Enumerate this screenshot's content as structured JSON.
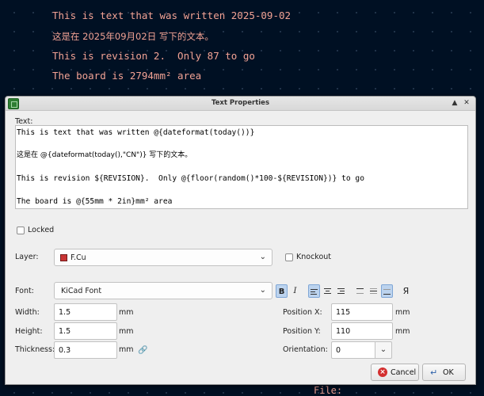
{
  "canvas": {
    "lines": [
      "This is text that was written 2025-09-02",
      "这是在 2025年09月02日 写下的文本。",
      "This is revision 2.  Only 87 to go",
      "The board is 2794mm² area"
    ],
    "bottom_label": "File:"
  },
  "dialog": {
    "title": "Text Properties",
    "text_label": "Text:",
    "text_lines": [
      "This is text that was written @{dateformat(today())}",
      "这是在 @{dateformat(today(),\"CN\")} 写下的文本。",
      "This is revision ${REVISION}.  Only @{floor(random()*100-${REVISION})} to go",
      "The board is @{55mm * 2in}mm² area"
    ],
    "locked_label": "Locked",
    "layer_label": "Layer:",
    "layer_value": "F.Cu",
    "layer_color": "#c83434",
    "knockout_label": "Knockout",
    "font_label": "Font:",
    "font_value": "KiCad Font",
    "bold_label": "B",
    "italic_label": "I",
    "mirror_label": "Я",
    "width_label": "Width:",
    "width_value": "1.5",
    "height_label": "Height:",
    "height_value": "1.5",
    "thickness_label": "Thickness:",
    "thickness_value": "0.3",
    "unit": "mm",
    "pos_x_label": "Position X:",
    "pos_x_value": "115",
    "pos_y_label": "Position Y:",
    "pos_y_value": "110",
    "orientation_label": "Orientation:",
    "orientation_value": "0",
    "cancel_label": "Cancel",
    "ok_label": "OK",
    "cancel_icon": "×",
    "spin_icon": "⌄",
    "link_icon": "🔗",
    "dropdown_icon": "⌄",
    "maximize_icon": "▲",
    "close_icon": "✕"
  }
}
